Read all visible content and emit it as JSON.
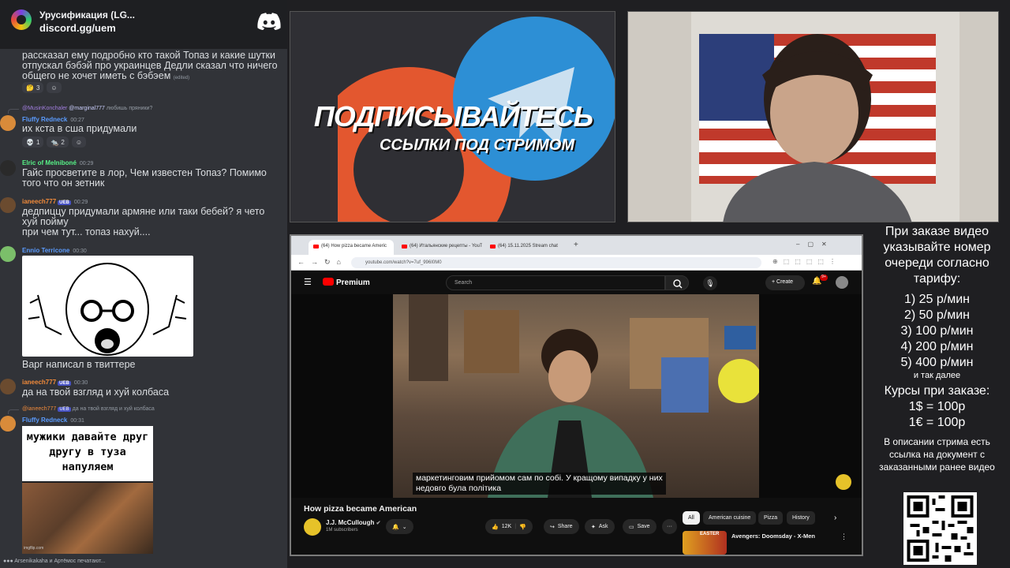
{
  "chat": {
    "server_name": "Урусификация (LG...",
    "server_invite": "discord.gg/uem",
    "messages": [
      {
        "text": "рассказал ему подробно кто такой Топаз и какие шутки отпускал бэбэй про украинцев Дедли сказал что ничего общего не хочет иметь с бэбэем",
        "edited": "(edited)",
        "reactions": [
          {
            "icon": "thinking-emoji",
            "count": "3"
          },
          {
            "icon": "add-reaction-icon",
            "count": ""
          }
        ]
      },
      {
        "reply_to": "@MusinKonchaler",
        "reply_mention": "@marginal777",
        "reply_text": "любишь пряники?",
        "author": "Fluffy Redneck",
        "time": "00:27",
        "text": "их кста в сша придумали",
        "reactions": [
          {
            "icon": "skull-emoji",
            "count": "1"
          },
          {
            "icon": "rat-emoji",
            "count": "2"
          },
          {
            "icon": "add-reaction-icon",
            "count": ""
          }
        ]
      },
      {
        "author": "Elric of Melniboné",
        "time": "00:29",
        "text": "Гайс просветите в лор, Чем известен Топаз? Помимо того что он зетник"
      },
      {
        "author": "ianeech777",
        "tag": "UEB",
        "time": "00:29",
        "text": "дедпиццу придумали армяне или таки бебей? я чето хуй пойму",
        "text2": "при чем тут... топаз нахуй...."
      },
      {
        "author": "Ennio Terricone",
        "time": "00:30",
        "text": "Варг написал в твиттере"
      },
      {
        "author": "ianeech777",
        "tag": "UEB",
        "time": "00:30",
        "text": "да на твой взгляд и хуй колбаса"
      },
      {
        "reply_to": "@ianeech777",
        "reply_tag": "UEB",
        "reply_text": "да на твой взгляд и хуй колбаса",
        "author": "Fluffy Redneck",
        "time": "00:31",
        "meme_text": "мужики давайте друг другу в туза напуляем",
        "meme_source": "imgflip.com"
      }
    ],
    "typing": "Arsenikakaha и Артёмос печатают..."
  },
  "promo": {
    "title": "ПОДПИСЫВАЙТЕСЬ",
    "subtitle": "ССЫЛКИ ПОД СТРИМОМ"
  },
  "browser": {
    "tabs": [
      {
        "label": "(64) How pizza became Americ"
      },
      {
        "label": "(64) Итальянские рецепты - YouTu"
      },
      {
        "label": "(64) 15.11.2025 Stream chat"
      }
    ],
    "url": "youtube.com/watch?v=7uf_996I0M0",
    "yt": {
      "logo": "Premium",
      "search_placeholder": "Search",
      "create_label": "Create",
      "notif_count": "9+",
      "subtitle_line1": "маркетинговим прийомом сам по собі. У кращому випадку у них",
      "subtitle_line2": "недовго була політика",
      "video_title": "How pizza became American",
      "channel_name": "J.J. McCullough",
      "channel_subs": "1M subscribers",
      "like_count": "12K",
      "share_label": "Share",
      "ask_label": "Ask",
      "save_label": "Save",
      "chips": [
        "All",
        "American cuisine",
        "Pizza",
        "History"
      ],
      "rec_title": "Avengers: Doomsday - X-Men",
      "rec_badge": "EASTER"
    }
  },
  "tariff": {
    "heading": "При заказе видео указывайте номер очереди согласно тарифу:",
    "prices": [
      "1) 25 р/мин",
      "2) 50 р/мин",
      "3) 100 р/мин",
      "4) 200 р/мин",
      "5) 400 р/мин"
    ],
    "etc": "и так далее",
    "courses_heading": "Курсы при заказе:",
    "courses": [
      "1$ = 100р",
      "1€ = 100р"
    ],
    "description_note": "В описании стрима есть ссылка на документ с заказанными ранее видео"
  }
}
